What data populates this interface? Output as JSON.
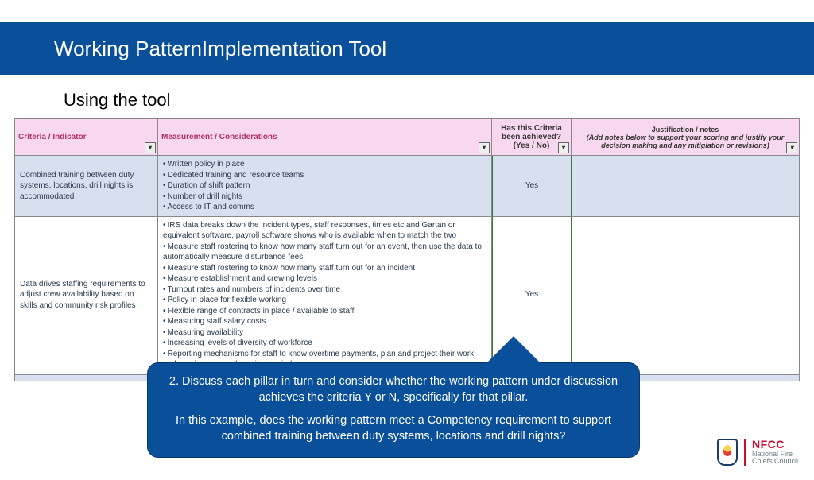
{
  "title": "Working PatternImplementation Tool",
  "subtitle": "Using the tool",
  "headers": {
    "criteria": "Criteria / Indicator",
    "measurement": "Measurement / Considerations",
    "achieved": "Has this Criteria been achieved? (Yes / No)",
    "justification_main": "Justification / notes",
    "justification_sub": "(Add notes below to support your scoring and justify your decision making and any mitigiation or revisions)"
  },
  "rows": [
    {
      "criteria": "Combined training between duty systems, locations, drill nights is accommodated",
      "measurements": [
        "Written policy in place",
        "Dedicated training and resource teams",
        "Duration of shift pattern",
        "Number of drill nights",
        "Access to IT and comms"
      ],
      "achieved": "Yes",
      "justification": ""
    },
    {
      "criteria": "Data drives staffing requirements to adjust crew availability based on skills and community risk profiles",
      "measurements": [
        "IRS data breaks down the incident types, staff responses, times etc and Gartan or equivalent software, payroll software shows who is available when to match the two",
        "Measure staff rostering to know how many staff turn out for an event, then use the data to automatically measure disturbance fees.",
        "Measure staff rostering to know how many staff turn out for an incident",
        "Measure establishment and crewing levels",
        "Turnout rates and numbers of incidents over time",
        "Policy in place for flexible working",
        "Flexible range of contracts in place / available to staff",
        "Measuring staff salary costs",
        "Measuring availability",
        "Increasing levels of diversity of workforce",
        "Reporting mechanisms for staff to know overtime payments, plan and project their work and earnings over a long time period"
      ],
      "achieved": "Yes",
      "justification": ""
    }
  ],
  "callout": {
    "p1": "2. Discuss each pillar in turn and consider whether the working pattern under discussion achieves the criteria Y or N, specifically for that pillar.",
    "p2": "In this example, does the working pattern meet a Competency requirement to support combined training between duty systems, locations and drill nights?"
  },
  "logo": {
    "acronym": "NFCC",
    "line2a": "National Fire",
    "line2b": "Chiefs Council"
  }
}
